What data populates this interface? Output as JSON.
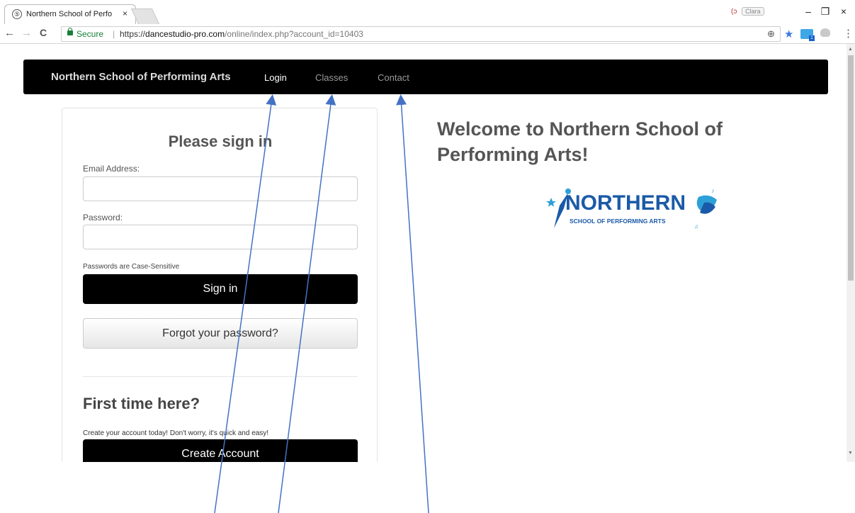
{
  "browser": {
    "tab_title": "Northern School of Perfo",
    "tab_close": "×",
    "profile_icon": "(ↄ",
    "profile_name": "Clara",
    "window_controls": [
      "–",
      "❐",
      "×"
    ],
    "nav": {
      "back": "←",
      "forward": "→",
      "reload": "C"
    },
    "secure_label": "Secure",
    "separator": "|",
    "url_scheme": "https://",
    "url_host": "dancestudio-pro.com",
    "url_path": "/online/index.php?account_id=10403",
    "zoom_icon": "⊕",
    "star_icon": "★",
    "extension_badge": "1",
    "menu_icon": "⋮"
  },
  "navbar": {
    "brand": "Northern School of Performing Arts",
    "links": [
      "Login",
      "Classes",
      "Contact"
    ],
    "active": "Login"
  },
  "signin": {
    "title": "Please sign in",
    "email_label": "Email Address:",
    "email_value": "",
    "password_label": "Password:",
    "password_value": "",
    "password_hint": "Passwords are Case-Sensitive",
    "signin_button": "Sign in",
    "forgot_button": "Forgot your password?",
    "first_title": "First time here?",
    "first_text": "Create your account today! Don't worry, it's quick and easy!",
    "create_button": "Create Account"
  },
  "welcome": {
    "heading": "Welcome to Northern School of Performing Arts!"
  },
  "logo": {
    "name": "NORTHERN",
    "tagline": "SCHOOL OF PERFORMING ARTS"
  },
  "colors": {
    "navbar_bg": "#000000",
    "button_bg": "#000000",
    "secure_green": "#188038",
    "logo_blue": "#1b5aa8",
    "arrow_blue": "#4472c4"
  }
}
